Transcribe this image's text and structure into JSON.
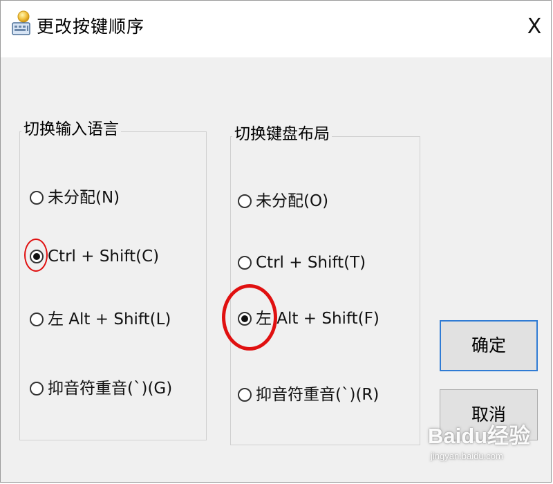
{
  "window": {
    "title": "更改按键顺序",
    "close_label": "X"
  },
  "groups": [
    {
      "label": "切换输入语言",
      "options": [
        {
          "label": "未分配(N)",
          "checked": false
        },
        {
          "label": "Ctrl + Shift(C)",
          "checked": true
        },
        {
          "label": "左 Alt + Shift(L)",
          "checked": false
        },
        {
          "label": "抑音符重音(`)(G)",
          "checked": false
        }
      ]
    },
    {
      "label": "切换键盘布局",
      "options": [
        {
          "label": "未分配(O)",
          "checked": false
        },
        {
          "label": "Ctrl + Shift(T)",
          "checked": false
        },
        {
          "label": "左 Alt + Shift(F)",
          "checked": true
        },
        {
          "label": "抑音符重音(`)(R)",
          "checked": false
        }
      ]
    }
  ],
  "buttons": {
    "ok_label": "确定",
    "cancel_label": "取消"
  },
  "watermark": {
    "main": "Baidu经验",
    "sub": "jingyan.baidu.com"
  },
  "colors": {
    "dialog_bg": "#f0f0f0",
    "titlebar_bg": "#ffffff",
    "accent_border": "#2f7bd4",
    "highlight_red": "#e01010"
  },
  "icons": {
    "app_icon": "keyboard-icon",
    "close_icon": "close-icon"
  }
}
